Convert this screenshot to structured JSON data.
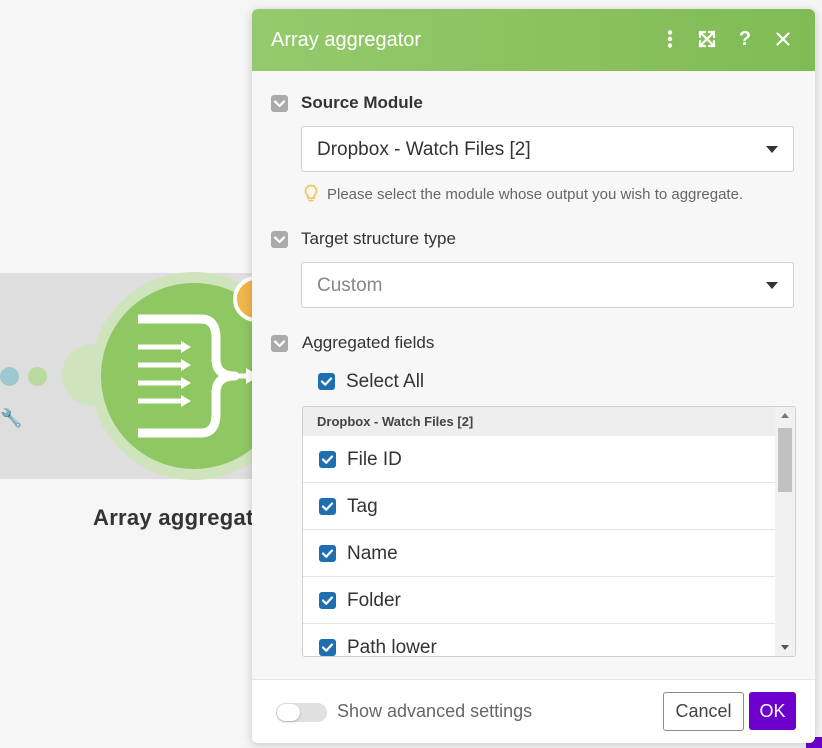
{
  "canvas": {
    "module_label": "Array aggregator"
  },
  "dialog": {
    "title": "Array aggregator",
    "header_icons": [
      "more-vertical-icon",
      "expand-icon",
      "help-icon",
      "close-icon"
    ],
    "source_module": {
      "label": "Source Module",
      "value": "Dropbox - Watch Files [2]",
      "hint": "Please select the module whose output you wish to aggregate."
    },
    "target_structure": {
      "label": "Target structure type",
      "value": "Custom"
    },
    "aggregated_fields": {
      "label": "Aggregated fields",
      "select_all_label": "Select All",
      "group_label": "Dropbox - Watch Files [2]",
      "fields": [
        {
          "label": "File ID",
          "checked": true
        },
        {
          "label": "Tag",
          "checked": true
        },
        {
          "label": "Name",
          "checked": true
        },
        {
          "label": "Folder",
          "checked": true
        },
        {
          "label": "Path lower",
          "checked": true
        }
      ]
    },
    "footer": {
      "advanced_toggle_label": "Show advanced settings",
      "advanced_enabled": false,
      "cancel_label": "Cancel",
      "ok_label": "OK"
    }
  },
  "colors": {
    "header_green": "#8cc562",
    "module_green": "#8fc763",
    "checkbox_blue": "#1f6fb0",
    "ok_purple": "#6d00cc",
    "badge_orange": "#f0b64a"
  }
}
